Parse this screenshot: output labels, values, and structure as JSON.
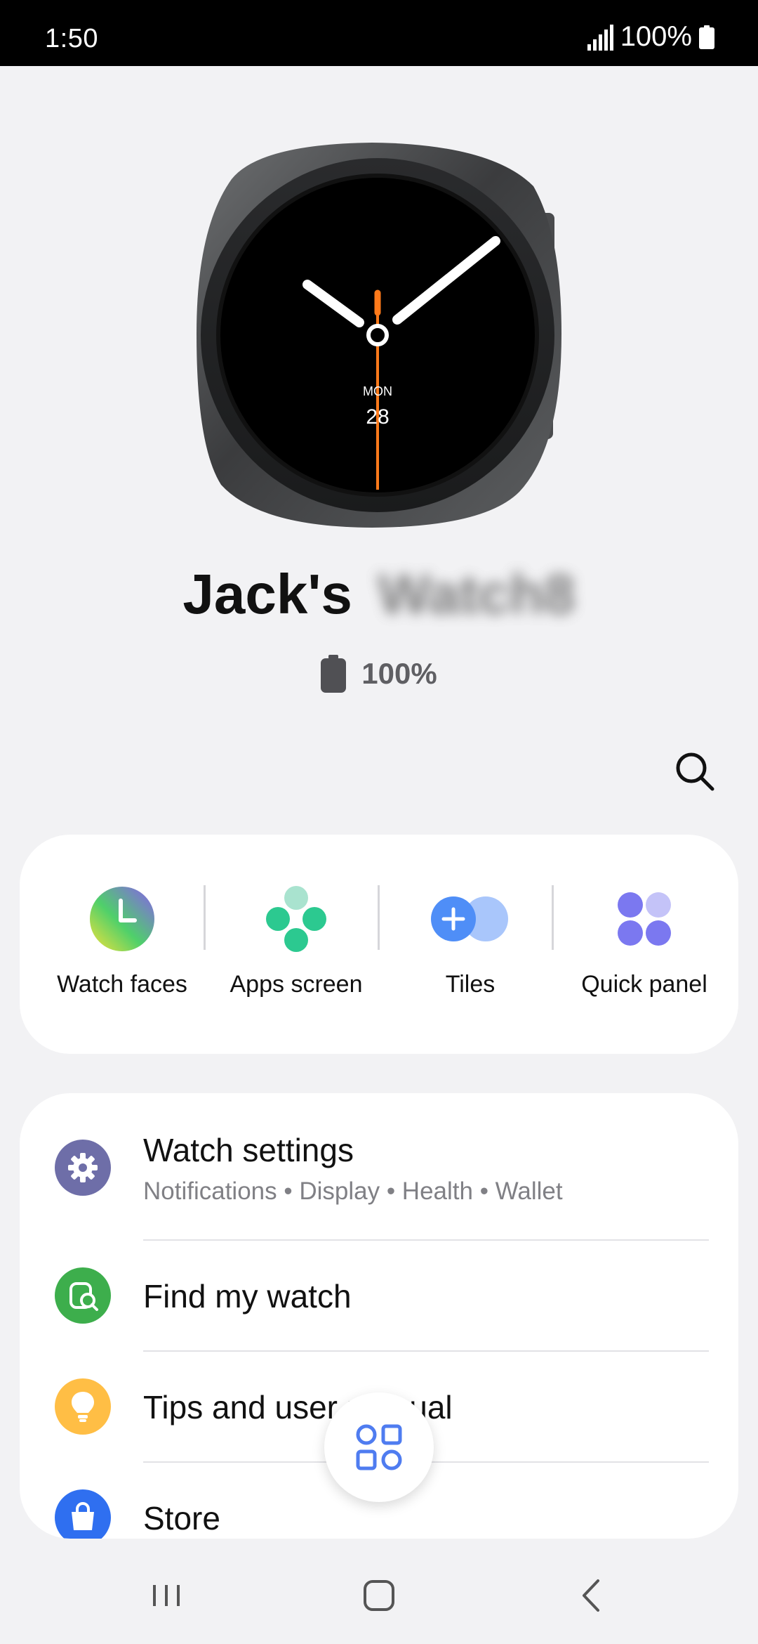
{
  "status_bar": {
    "time": "1:50",
    "battery": "100%"
  },
  "watch": {
    "face_day": "MON",
    "face_date": "28",
    "name_owner": "Jack's",
    "name_model": "Watch8",
    "battery": "100%"
  },
  "shortcuts": [
    {
      "label": "Watch faces",
      "icon": "watch-faces-icon"
    },
    {
      "label": "Apps screen",
      "icon": "apps-screen-icon"
    },
    {
      "label": "Tiles",
      "icon": "tiles-icon"
    },
    {
      "label": "Quick panel",
      "icon": "quick-panel-icon"
    }
  ],
  "menu": {
    "items": [
      {
        "title": "Watch settings",
        "subtitle": "Notifications • Display • Health • Wallet",
        "icon": "gear-icon"
      },
      {
        "title": "Find my watch",
        "icon": "find-watch-icon"
      },
      {
        "title": "Tips and user manual",
        "icon": "lightbulb-icon"
      },
      {
        "title": "Store",
        "icon": "shopping-bag-icon"
      }
    ]
  },
  "colors": {
    "accent_orange": "#ff7a1a",
    "settings_purple": "#6e6ea8",
    "find_green": "#3dae4c",
    "tips_yellow": "#ffbe45",
    "store_blue": "#2f6ff0",
    "apps_green": "#2cc990",
    "tiles_blue": "#4f8ef7",
    "quick_purple": "#7b78f0"
  }
}
